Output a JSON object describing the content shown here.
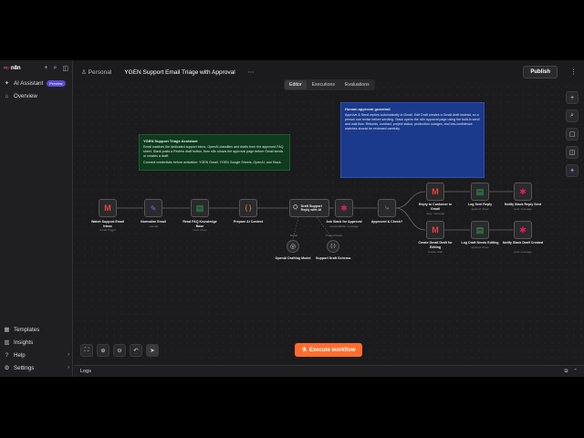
{
  "sidebar": {
    "logo_text": "n8n",
    "top_icons": [
      "plus-icon",
      "search-icon",
      "panel-icon"
    ],
    "ai_assistant": {
      "label": "AI Assistant",
      "badge": "Preview"
    },
    "overview": "Overview",
    "bottom_items": [
      {
        "label": "Templates",
        "icon": "templates-icon"
      },
      {
        "label": "Insights",
        "icon": "insights-icon"
      },
      {
        "label": "Help",
        "icon": "help-icon"
      },
      {
        "label": "Settings",
        "icon": "settings-icon"
      }
    ]
  },
  "header": {
    "project": "Personal",
    "title": "YGEN Support Email Triage with Approval",
    "more": "⋯",
    "publish": "Publish",
    "menu": "⋮"
  },
  "tabs": [
    {
      "label": "Editor",
      "active": true
    },
    {
      "label": "Executions",
      "active": false
    },
    {
      "label": "Evaluations",
      "active": false
    }
  ],
  "stickies": [
    {
      "title": "YGEN Support Triage Assistant",
      "lines": [
        "Email watches the dedicated support inbox, OpenAI classifies and drafts from the approved FAQ sheet, Slack posts a Review draft button, then n8n shows the approval page before Gmail sends or creates a draft.",
        "Connect credentials before activation: YGEN Gmail, YGEN Google Sheets, OpenAI, and Slack."
      ],
      "bg": "#0e3b1e"
    },
    {
      "title": "Human approval guardrail",
      "lines": [
        "Approve & Send replies automatically in Gmail. Edit Draft creates a Gmail draft instead, so a person can revise before sending. Slack opens the n8n approval page using the built-in send and wait flow. Refunds, contract, project status, production outages, and low-confidence matches should be reviewed carefully."
      ],
      "bg": "#1b3a8c"
    }
  ],
  "nodes": [
    {
      "label": "Watch Support Email Inbox",
      "sub": "Gmail Trigger",
      "icon": "gmail-icon"
    },
    {
      "label": "Normalize Email",
      "sub": "manual",
      "icon": "edit-icon"
    },
    {
      "label": "Read FAQ Knowledge Base",
      "sub": "read: sheet",
      "icon": "sheets-icon"
    },
    {
      "label": "Prepare AI Context",
      "sub": "",
      "icon": "code-icon"
    },
    {
      "label": "Draft Support Reply with AI",
      "sub": "",
      "icon": "ai-agent-icon"
    },
    {
      "label": "Ask Slack for Approval",
      "sub": "sendAndWait: message",
      "icon": "slack-icon"
    },
    {
      "label": "Approved & Check?",
      "sub": "",
      "icon": "if-icon"
    },
    {
      "label": "Reply to Customer in Gmail",
      "sub": "reply: message",
      "icon": "gmail-icon"
    },
    {
      "label": "Log Sent Reply",
      "sub": "append: sheet",
      "icon": "sheets-icon"
    },
    {
      "label": "Notify Slack Reply Sent",
      "sub": "post: message",
      "icon": "slack-icon"
    },
    {
      "label": "Create Gmail Draft for Editing",
      "sub": "create: draft",
      "icon": "gmail-icon"
    },
    {
      "label": "Log Draft Needs Editing",
      "sub": "append: sheet",
      "icon": "sheets-icon"
    },
    {
      "label": "Notify Slack Draft Created",
      "sub": "post: message",
      "icon": "slack-icon"
    },
    {
      "label": "OpenAI Drafting Model",
      "sub": "",
      "icon": "openai-icon"
    },
    {
      "label": "Support Draft Schema",
      "sub": "",
      "icon": "schema-icon"
    }
  ],
  "sub_labels": {
    "model": "Model",
    "output": "Output Parser"
  },
  "right_tools": [
    "plus-icon",
    "search-icon",
    "sticky-icon",
    "panel-icon",
    "sparkle-icon"
  ],
  "bottom_tools": [
    "fit-view-icon",
    "zoom-in-icon",
    "zoom-out-icon",
    "undo-icon",
    "pointer-icon"
  ],
  "execute_button": "Execute workflow",
  "logs": {
    "label": "Logs"
  },
  "colors": {
    "accent": "#ff6d2d",
    "badge": "#5b4bd6",
    "brand": "#ea4b71"
  }
}
